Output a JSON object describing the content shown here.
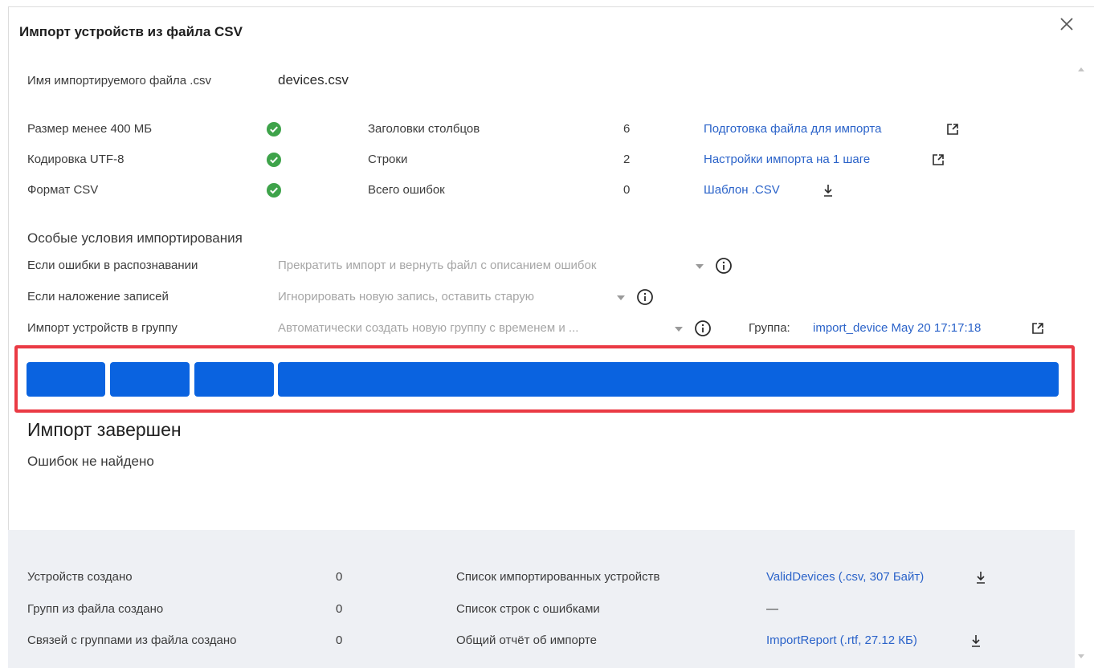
{
  "dialog": {
    "title": "Импорт устройств из файла CSV",
    "file_label": "Имя импортируемого файла .csv",
    "file_name": "devices.csv"
  },
  "checks": [
    {
      "label": "Размер менее 400 МБ",
      "status_icon": "check-circle-icon"
    },
    {
      "label": "Кодировка UTF-8",
      "status_icon": "check-circle-icon"
    },
    {
      "label": "Формат CSV",
      "status_icon": "check-circle-icon"
    }
  ],
  "stats": [
    {
      "label": "Заголовки столбцов",
      "value": "6"
    },
    {
      "label": "Строки",
      "value": "2"
    },
    {
      "label": "Всего ошибок",
      "value": "0"
    }
  ],
  "links": [
    {
      "label": "Подготовка файла для импорта",
      "icon": "external-link-icon"
    },
    {
      "label": "Настройки импорта на 1 шаге",
      "icon": "external-link-icon"
    },
    {
      "label": "Шаблон .CSV",
      "icon": "download-icon"
    }
  ],
  "conditions": {
    "heading": "Особые условия импортирования",
    "rows": [
      {
        "label": "Если ошибки в распознавании",
        "value": "Прекратить импорт и вернуть файл с описанием ошибок"
      },
      {
        "label": "Если наложение записей",
        "value": "Игнорировать новую запись, оставить старую"
      },
      {
        "label": "Импорт устройств в группу",
        "value": "Автоматически создать новую группу с временем и ..."
      }
    ],
    "group_label": "Группа:",
    "group_value": "import_device May 20 17:17:18"
  },
  "progress": {
    "segments": 4,
    "color": "#0a63e0",
    "highlight_color": "#ea3a44"
  },
  "result": {
    "title": "Импорт завершен",
    "subtitle": "Ошибок не найдено"
  },
  "summary": {
    "counts": [
      {
        "label": "Устройств создано",
        "value": "0"
      },
      {
        "label": "Групп из файла создано",
        "value": "0"
      },
      {
        "label": "Связей с группами из файла создано",
        "value": "0"
      }
    ],
    "files": [
      {
        "label": "Список импортированных устройств",
        "value": "ValidDevices (.csv, 307 Байт)",
        "has_link": true
      },
      {
        "label": "Список строк с ошибками",
        "value": "—",
        "has_link": false
      },
      {
        "label": "Общий отчёт об импорте",
        "value": "ImportReport (.rtf, 27.12 КБ)",
        "has_link": true
      }
    ]
  }
}
